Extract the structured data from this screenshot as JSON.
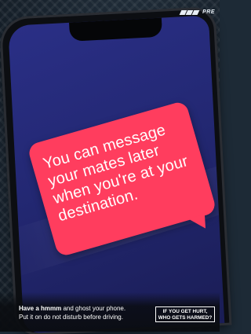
{
  "message": "You can message your mates later when you're at your destination.",
  "brand": {
    "logo_text": "PRE"
  },
  "footer": {
    "tagline_bold": "Have a hmmm",
    "tagline_rest": " and ghost your phone.",
    "tagline_line2": "Put it on do not disturb before driving.",
    "slogan": "IF YOU GET HURT, WHO GETS HARMED?"
  },
  "colors": {
    "bubble": "#ff3d5e",
    "screen": "#232873",
    "background": "#1d2a36"
  }
}
